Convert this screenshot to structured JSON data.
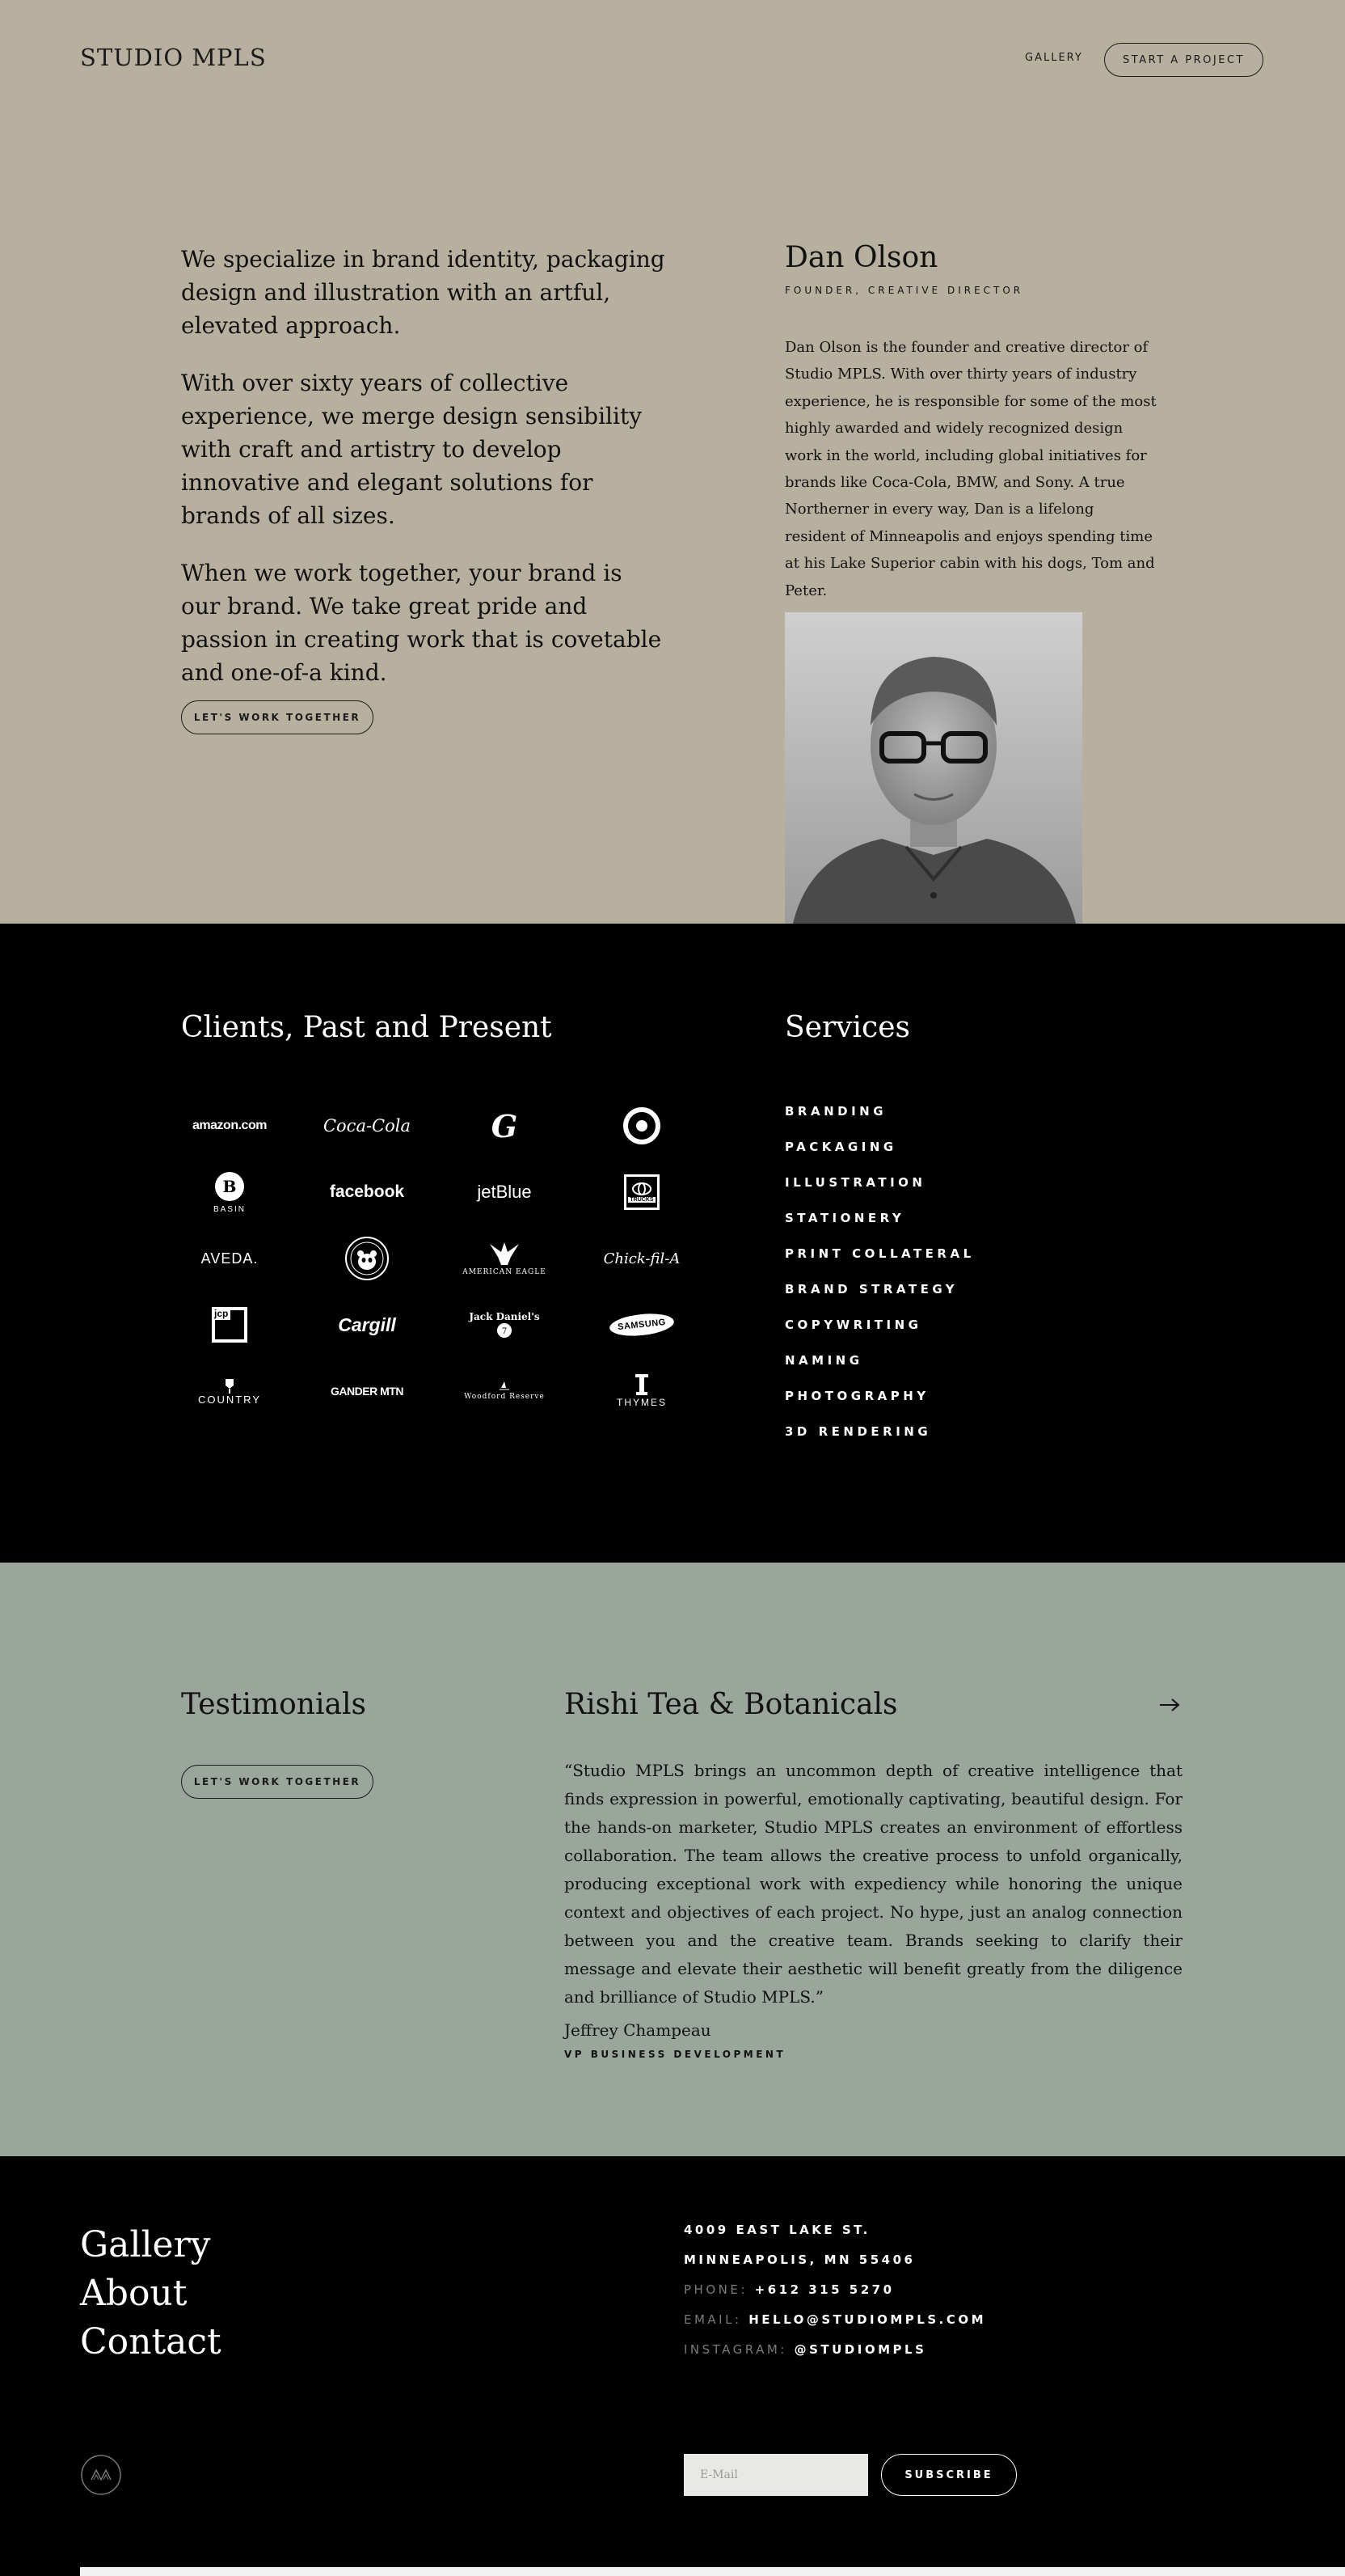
{
  "header": {
    "logo": "STUDIO MPLS",
    "nav_gallery": "GALLERY",
    "start_project": "START A PROJECT"
  },
  "about": {
    "paragraphs": [
      "We specialize in brand identity, packaging design and illustration with an artful, elevated approach.",
      "With over sixty years of collective experience, we merge design sensibility with craft and artistry to develop innovative and elegant solutions for brands of all sizes.",
      "When we work together, your brand is our brand. We take great pride and passion in creating work that is covetable and one-of-a kind."
    ],
    "cta": "LET'S WORK TOGETHER",
    "bio_name": "Dan Olson",
    "bio_role": "FOUNDER, CREATIVE DIRECTOR",
    "bio_text": "Dan Olson is the founder and creative director of Studio MPLS. With over thirty years of industry experience, he is responsible for some of the most highly awarded and widely recognized design work in the world, including global initiatives for brands like Coca-Cola, BMW, and Sony. A true Northerner in every way, Dan is a lifelong resident of Minneapolis and enjoys spending time at his Lake Superior cabin with his dogs, Tom and Peter."
  },
  "clients": {
    "title": "Clients, Past and Present",
    "logos": [
      {
        "name": "amazon",
        "text": "amazon.com"
      },
      {
        "name": "coca-cola",
        "text": "Coca-Cola"
      },
      {
        "name": "general-mills",
        "text": "G"
      },
      {
        "name": "target",
        "text": ""
      },
      {
        "name": "basin",
        "text": "BASIN"
      },
      {
        "name": "facebook",
        "text": "facebook"
      },
      {
        "name": "jetblue",
        "text": "jetBlue"
      },
      {
        "name": "toyota-trucks",
        "text": "TRUCKS"
      },
      {
        "name": "aveda",
        "text": "AVEDA."
      },
      {
        "name": "wwf",
        "text": ""
      },
      {
        "name": "american-eagle",
        "text": "AMERICAN EAGLE"
      },
      {
        "name": "chick-fil-a",
        "text": "Chick-fil-A"
      },
      {
        "name": "jcpenney",
        "text": "jcp"
      },
      {
        "name": "cargill",
        "text": "Cargill"
      },
      {
        "name": "jack-daniels",
        "text": "Jack Daniel's"
      },
      {
        "name": "samsung",
        "text": "SAMSUNG"
      },
      {
        "name": "country-inns",
        "text": "COUNTRY"
      },
      {
        "name": "gander-mtn",
        "text": "GANDER MTN"
      },
      {
        "name": "woodford-reserve",
        "text": "Woodford Reserve"
      },
      {
        "name": "thymes",
        "text": "THYMES"
      }
    ]
  },
  "services": {
    "title": "Services",
    "items": [
      "BRANDING",
      "PACKAGING",
      "ILLUSTRATION",
      "STATIONERY",
      "PRINT COLLATERAL",
      "BRAND STRATEGY",
      "COPYWRITING",
      "NAMING",
      "PHOTOGRAPHY",
      "3D RENDERING"
    ]
  },
  "testimonials": {
    "title": "Testimonials",
    "cta": "LET'S WORK TOGETHER",
    "brand": "Rishi Tea & Botanicals",
    "quote": "“Studio MPLS brings an uncommon depth of creative intelligence that finds expression in powerful, emotionally captivating, beautiful design. For the hands-on marketer, Studio MPLS creates an environment of effortless collaboration. The team allows the creative process to unfold organically, producing exceptional work with expediency while honoring the unique context and objectives of each project. No hype, just an analog connection between you and the creative team. Brands seeking to clarify their message and elevate their aesthetic will benefit greatly from the diligence and brilliance of Studio MPLS.”",
    "author": "Jeffrey Champeau",
    "author_role": "VP BUSINESS DEVELOPMENT"
  },
  "footer": {
    "nav": [
      "Gallery",
      "About",
      "Contact"
    ],
    "address_line1": "4009 EAST LAKE ST.",
    "address_line2": "MINNEAPOLIS, MN 55406",
    "phone_label": "PHONE:",
    "phone": "+612 315 5270",
    "email_label": "EMAIL:",
    "email": "HELLO@STUDIOMPLS.COM",
    "instagram_label": "INSTAGRAM:",
    "instagram": "@STUDIOMPLS",
    "email_placeholder": "E-Mail",
    "subscribe": "SUBSCRIBE"
  },
  "colors": {
    "about_bg": "#b7b09f",
    "testimonials_bg": "#9aa59b",
    "dark_bg": "#000000"
  }
}
